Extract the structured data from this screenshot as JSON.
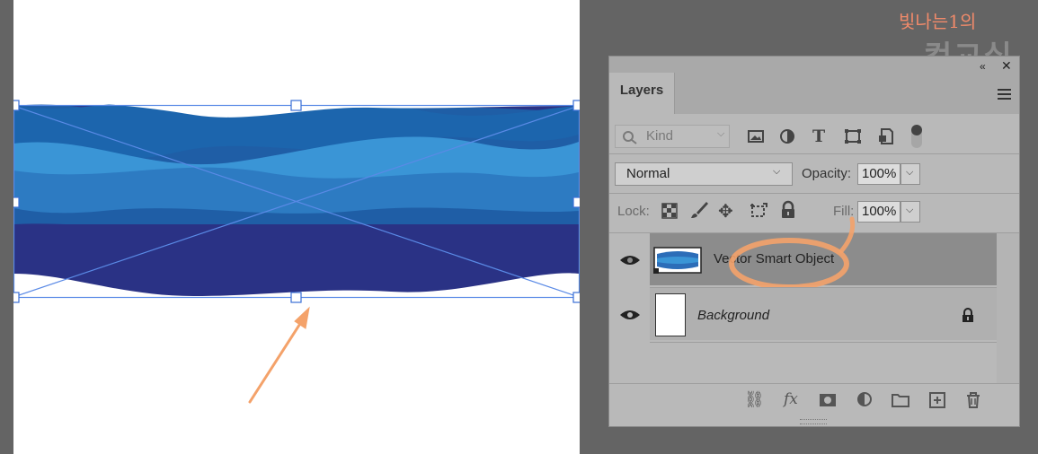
{
  "watermark": {
    "line1": "빛나는1의",
    "line2": "컴교실"
  },
  "layers_panel": {
    "tab_label": "Layers",
    "filter": {
      "placeholder": "Kind"
    },
    "blend_mode": "Normal",
    "opacity_label": "Opacity:",
    "opacity_value": "100%",
    "lock_label": "Lock:",
    "fill_label": "Fill:",
    "fill_value": "100%",
    "layers": [
      {
        "name": "Vector Smart Object",
        "visible": true,
        "selected": true
      },
      {
        "name": "Background",
        "visible": true,
        "locked": true
      }
    ]
  },
  "colors": {
    "selection": "#5a8ae6",
    "annotation": "#f4a26a",
    "wave_dark": "#2a3285",
    "wave_mid": "#1f62a8",
    "wave_light": "#3a95d6"
  }
}
